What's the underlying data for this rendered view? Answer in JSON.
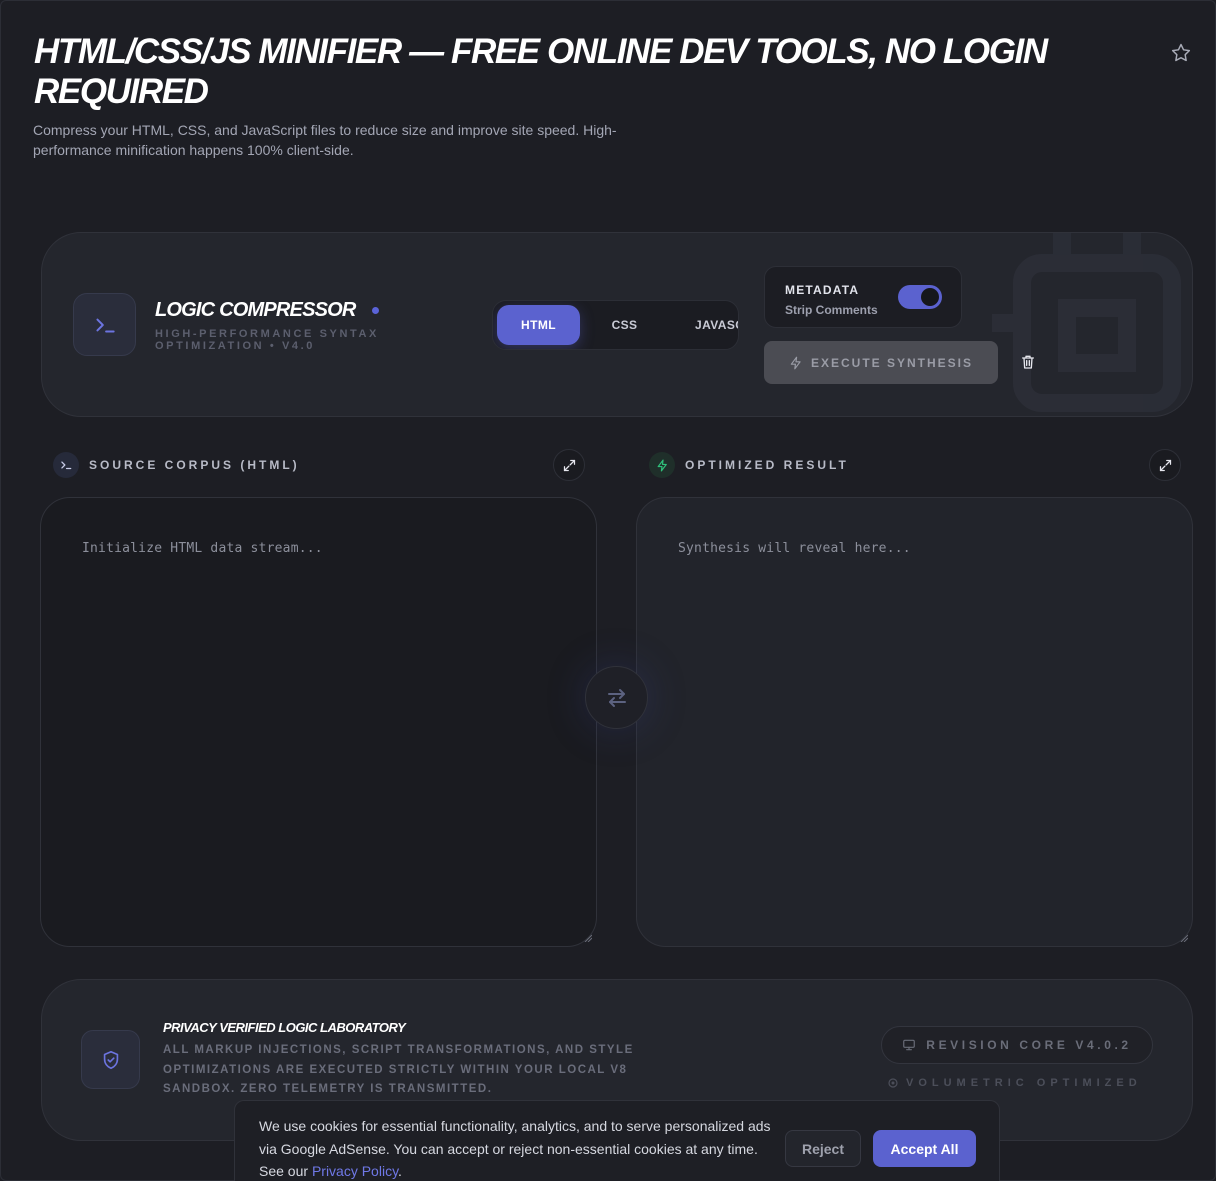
{
  "header": {
    "title": "HTML/CSS/JS Minifier — Free Online Dev Tools, No Login Required",
    "subtitle": "Compress your HTML, CSS, and JavaScript files to reduce size and improve site speed. High-performance minification happens 100% client-side."
  },
  "compressor": {
    "title": "Logic Compressor",
    "subtitle": "High-performance syntax optimization • v4.0",
    "tabs": [
      {
        "label": "HTML",
        "active": true
      },
      {
        "label": "CSS",
        "active": false
      },
      {
        "label": "JAVASC",
        "active": false
      }
    ],
    "metadata_label": "METADATA",
    "metadata_sub": "Strip Comments",
    "strip_comments_enabled": true,
    "execute_label": "EXECUTE SYNTHESIS"
  },
  "source": {
    "label": "SOURCE CORPUS (HTML)",
    "placeholder": "Initialize HTML data stream..."
  },
  "output": {
    "label": "OPTIMIZED RESULT",
    "placeholder": "Synthesis will reveal here..."
  },
  "privacy": {
    "title": "Privacy Verified Logic Laboratory",
    "text": "All markup injections, script transformations, and style optimizations are executed strictly within your local V8 sandbox. Zero telemetry is transmitted.",
    "revision": "REVISION CORE V4.0.2",
    "volumetric": "VOLUMETRIC OPTIMIZED"
  },
  "cookie": {
    "text": "We use cookies for essential functionality, analytics, and to serve personalized ads via Google AdSense. You can accept or reject non-essential cookies at any time. See our ",
    "link": "Privacy Policy",
    "after": ".",
    "reject": "Reject",
    "accept": "Accept All"
  },
  "colors": {
    "accent": "#5b62cf",
    "background": "#1d1e24",
    "success": "#2fbf7a"
  },
  "icons": {
    "favorite": "star-icon",
    "logo": "terminal-icon",
    "delete": "trash-icon",
    "expand": "expand-icon",
    "swap": "swap-icon",
    "optimized": "bolt-icon",
    "privacy": "shield-check-icon",
    "revision": "monitor-icon"
  }
}
